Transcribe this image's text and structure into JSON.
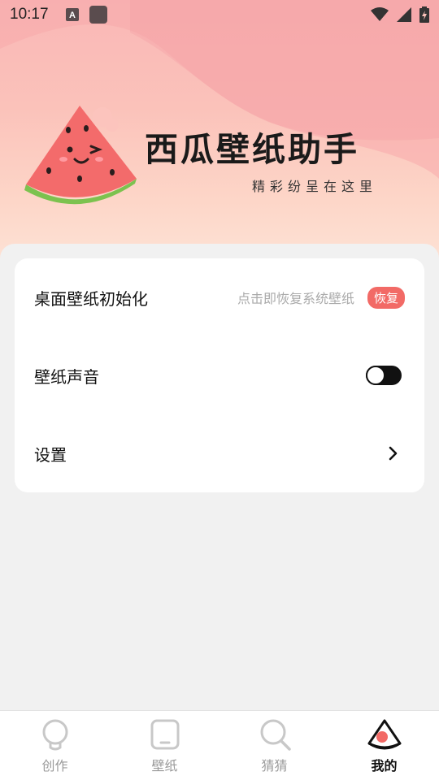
{
  "status_bar": {
    "time": "10:17",
    "icons": [
      "text-a-icon",
      "app-square-icon",
      "wifi-icon",
      "signal-icon",
      "battery-icon"
    ]
  },
  "brand": {
    "title": "西瓜壁纸助手",
    "subtitle": "精彩纷呈在这里",
    "logo_icon": "watermelon-slice-icon"
  },
  "settings": {
    "reset_wallpaper": {
      "label": "桌面壁纸初始化",
      "hint": "点击即恢复系统壁纸",
      "badge": "恢复"
    },
    "wallpaper_sound": {
      "label": "壁纸声音",
      "toggle_on": false
    },
    "settings_link": {
      "label": "设置",
      "icon": "chevron-right-icon"
    }
  },
  "tabbar": {
    "tabs": [
      {
        "label": "创作",
        "icon": "lightbulb-icon",
        "active": false
      },
      {
        "label": "壁纸",
        "icon": "phone-frame-icon",
        "active": false
      },
      {
        "label": "猜猜",
        "icon": "magnifier-icon",
        "active": false
      },
      {
        "label": "我的",
        "icon": "watermelon-icon",
        "active": true
      }
    ]
  },
  "colors": {
    "accent": "#f26a66",
    "hero_top": "#f9b7b6",
    "hero_bottom": "#fde3d6",
    "background": "#f1f1f1"
  }
}
